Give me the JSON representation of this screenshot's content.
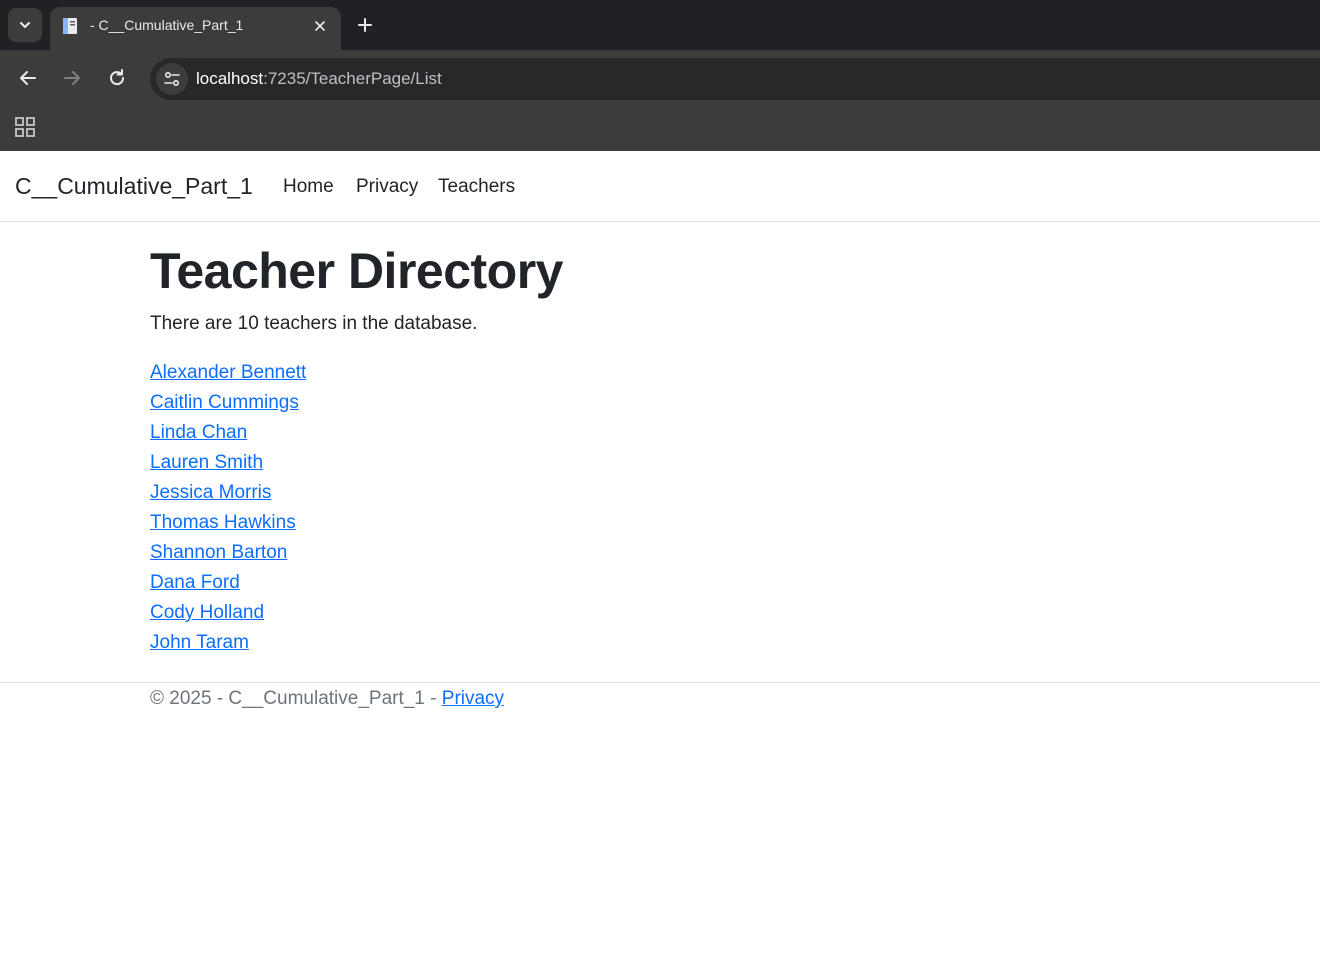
{
  "browser": {
    "tab_title": "- C__Cumulative_Part_1",
    "url_host": "localhost",
    "url_path": ":7235/TeacherPage/List"
  },
  "navbar": {
    "brand": "C__Cumulative_Part_1",
    "links": [
      "Home",
      "Privacy",
      "Teachers"
    ]
  },
  "main": {
    "heading": "Teacher Directory",
    "count_text": "There are 10 teachers in the database.",
    "teachers": [
      "Alexander Bennett",
      "Caitlin Cummings",
      "Linda Chan",
      "Lauren Smith",
      "Jessica Morris",
      "Thomas Hawkins",
      "Shannon Barton",
      "Dana Ford",
      "Cody Holland",
      "John Taram"
    ]
  },
  "footer": {
    "text": "© 2025 - C__Cumulative_Part_1 - ",
    "privacy_link": "Privacy"
  },
  "colors": {
    "link": "#0d6efd",
    "text": "#212529",
    "muted": "#6c757d",
    "chrome_dark": "#202124",
    "chrome_mid": "#3c3c3c"
  }
}
